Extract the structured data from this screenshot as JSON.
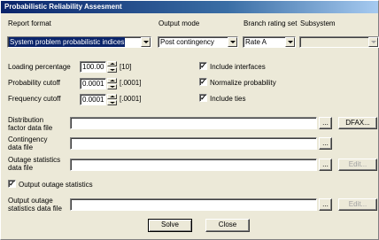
{
  "window": {
    "title": "Probabilistic Reliability Assesment"
  },
  "report_format": {
    "label": "Report format",
    "value": "System problem probabilistic indices"
  },
  "output_mode": {
    "label": "Output mode",
    "value": "Post contingency"
  },
  "branch_rating_set": {
    "label": "Branch rating set",
    "value": "Rate A"
  },
  "subsystem": {
    "label": "Subsystem",
    "value": ""
  },
  "loading_percentage": {
    "label": "Loading percentage",
    "value": "100.00",
    "hint": "[10]"
  },
  "probability_cutoff": {
    "label": "Probability cutoff",
    "value": "0.0001",
    "hint": "[.0001]"
  },
  "frequency_cutoff": {
    "label": "Frequency cutoff",
    "value": "0.0001",
    "hint": "[.0001]"
  },
  "options": {
    "include_interfaces": {
      "label": "Include interfaces",
      "checked": true
    },
    "normalize_probability": {
      "label": "Normalize probability",
      "checked": true
    },
    "include_ties": {
      "label": "Include ties",
      "checked": true
    }
  },
  "files": {
    "distribution_factor": {
      "label_line1": "Distribution",
      "label_line2": "factor data file",
      "value": "",
      "browse_label": "...",
      "action_label": "DFAX..."
    },
    "contingency": {
      "label_line1": "Contingency",
      "label_line2": "data file",
      "value": "",
      "browse_label": "..."
    },
    "outage_statistics": {
      "label_line1": "Outage statistics",
      "label_line2": "data file",
      "value": "",
      "browse_label": "...",
      "action_label": "Edit..."
    },
    "output_outage_statistics": {
      "label_line1": "Output outage",
      "label_line2": "statistics data file",
      "value": "",
      "browse_label": "...",
      "action_label": "Edit..."
    }
  },
  "output_outage_statistics_checkbox": {
    "label": "Output outage statistics",
    "checked": true
  },
  "check_glyph": "✓",
  "buttons": {
    "solve": "Solve",
    "close": "Close"
  }
}
